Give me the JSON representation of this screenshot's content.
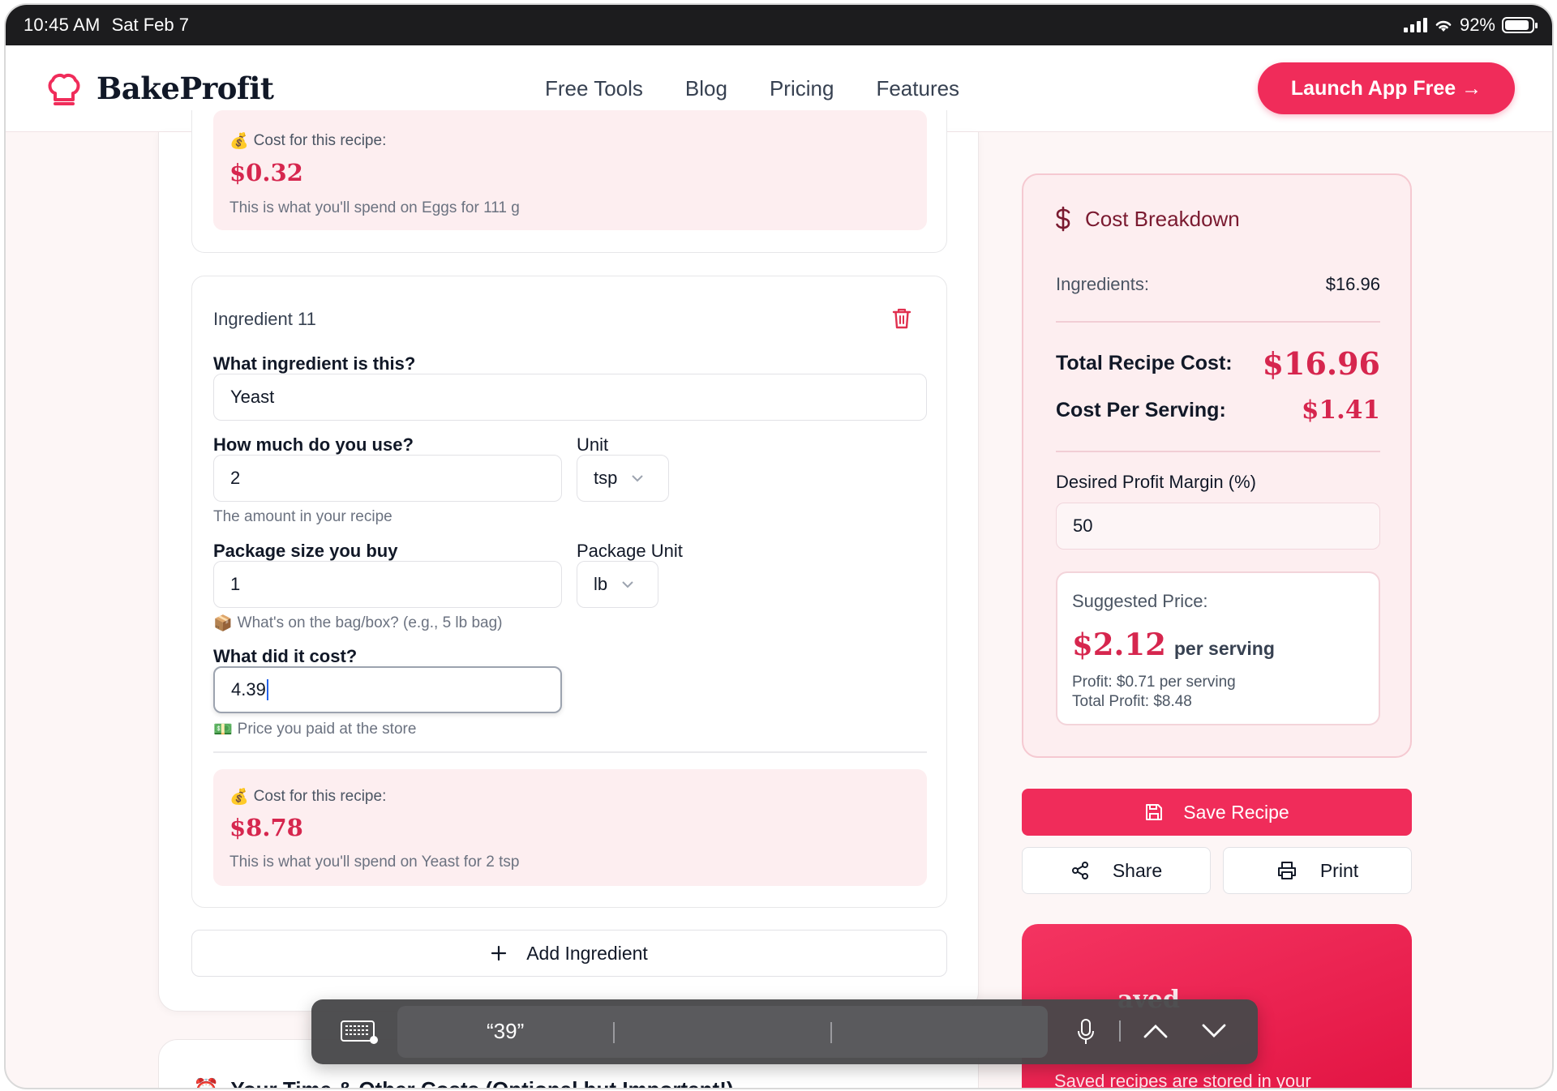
{
  "status_bar": {
    "time": "10:45 AM",
    "date": "Sat Feb 7",
    "battery": "92%"
  },
  "nav": {
    "brand": "BakeProfit",
    "links": [
      "Free Tools",
      "Blog",
      "Pricing",
      "Features"
    ],
    "cta": "Launch App Free →"
  },
  "prev_ingredient": {
    "cost_label": "Cost for this recipe:",
    "cost_value": "$0.32",
    "cost_note": "This is what you'll spend on Eggs for 111 g"
  },
  "ingredient": {
    "title": "Ingredient 11",
    "name_label": "What ingredient is this?",
    "name_value": "Yeast",
    "amount_label": "How much do you use?",
    "amount_value": "2",
    "amount_hint": "The amount in your recipe",
    "unit_label": "Unit",
    "unit_value": "tsp",
    "package_label": "Package size you buy",
    "package_value": "1",
    "package_hint": "What's on the bag/box? (e.g., 5 lb bag)",
    "package_unit_label": "Package Unit",
    "package_unit_value": "lb",
    "cost_q_label": "What did it cost?",
    "cost_q_value": "4.39",
    "cost_q_hint": "Price you paid at the store",
    "cost_label": "Cost for this recipe:",
    "cost_value": "$8.78",
    "cost_note": "This is what you'll spend on Yeast for 2 tsp"
  },
  "add_ingredient": "Add Ingredient",
  "time_section": {
    "title": "Your Time & Other Costs (Optional but Important!)"
  },
  "breakdown": {
    "title": "Cost Breakdown",
    "ingredients_label": "Ingredients:",
    "ingredients_value": "$16.96",
    "total_label": "Total Recipe Cost:",
    "total_value": "$16.96",
    "per_serving_label": "Cost Per Serving:",
    "per_serving_value": "$1.41",
    "margin_label": "Desired Profit Margin (%)",
    "margin_value": "50",
    "suggested_label": "Suggested Price:",
    "suggested_value": "$2.12",
    "suggested_unit": "per serving",
    "profit_line": "Profit: $0.71 per serving",
    "total_profit_line": "Total Profit: $8.48"
  },
  "actions": {
    "save": "Save Recipe",
    "share": "Share",
    "print": "Print"
  },
  "saved_card": {
    "title": "aved",
    "note": "Saved recipes are stored in your"
  },
  "dictation": {
    "word": "“39”"
  },
  "colors": {
    "accent": "#f02c5a",
    "price": "#d6264e",
    "tint": "#fdeef0"
  }
}
